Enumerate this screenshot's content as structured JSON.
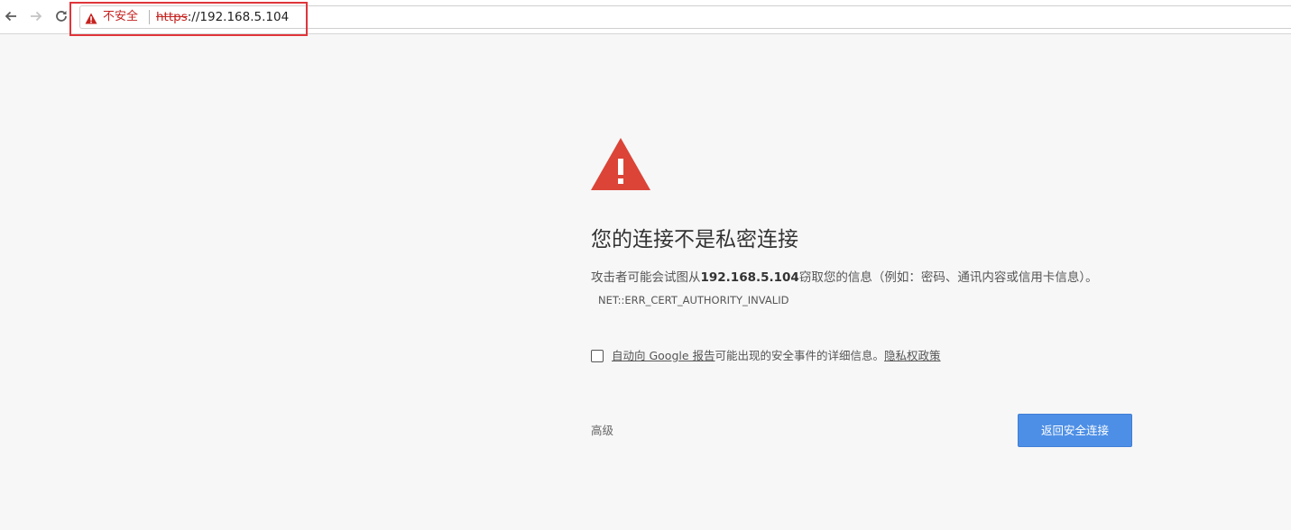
{
  "browser": {
    "security_label": "不安全",
    "url_scheme": "https",
    "url_rest": "://192.168.5.104"
  },
  "page": {
    "heading": "您的连接不是私密连接",
    "desc_before": "攻击者可能会试图从",
    "host": "192.168.5.104",
    "desc_after": "窃取您的信息（例如：密码、通讯内容或信用卡信息）。",
    "error_code": "NET::ERR_CERT_AUTHORITY_INVALID",
    "report_link": "自动向 Google 报告",
    "report_text": "可能出现的安全事件的详细信息。",
    "privacy_link": "隐私权政策",
    "advanced_label": "高级",
    "back_button_label": "返回安全连接"
  },
  "colors": {
    "warning_red": "#db4437",
    "primary_blue": "#4d8fe6",
    "highlight_red": "#e0353b"
  }
}
